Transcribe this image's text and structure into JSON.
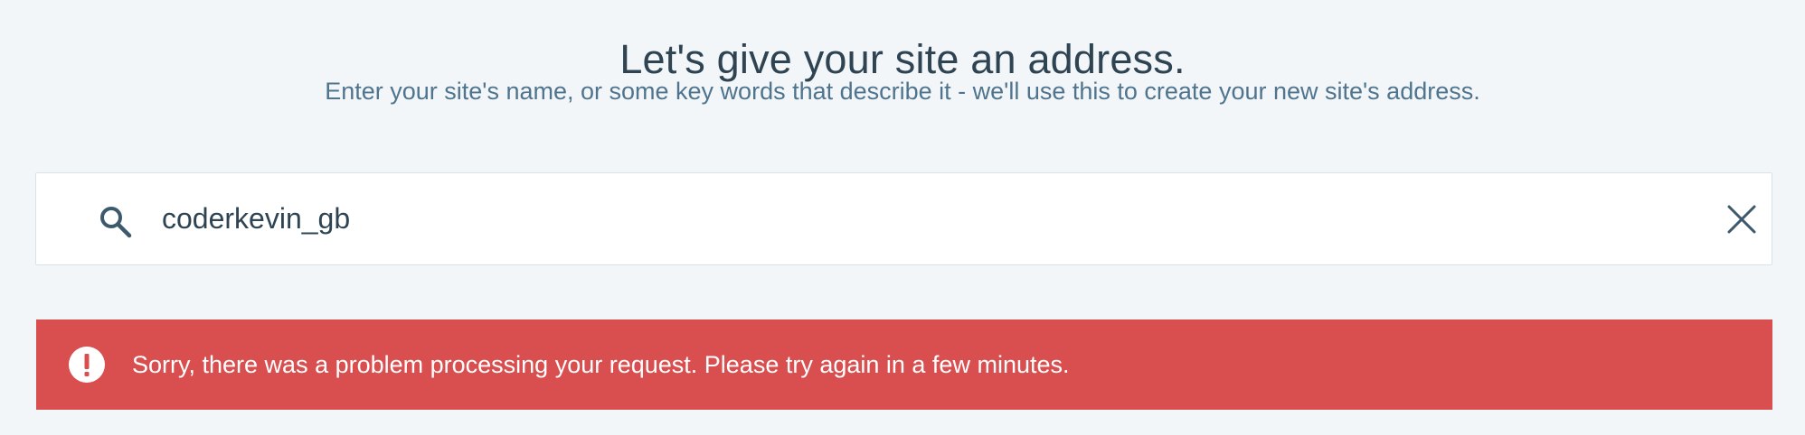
{
  "header": {
    "title": "Let's give your site an address.",
    "subtitle": "Enter your site's name, or some key words that describe it - we'll use this to create your new site's address."
  },
  "search": {
    "value": "coderkevin_gb",
    "icon": "search-icon",
    "clear_icon": "close-icon"
  },
  "notice": {
    "icon": "alert-icon",
    "message": "Sorry, there was a problem processing your request. Please try again in a few minutes.",
    "color": "#d94f4f"
  },
  "colors": {
    "background": "#f3f6f8",
    "text_primary": "#2e4453",
    "text_secondary": "#4f748e"
  }
}
